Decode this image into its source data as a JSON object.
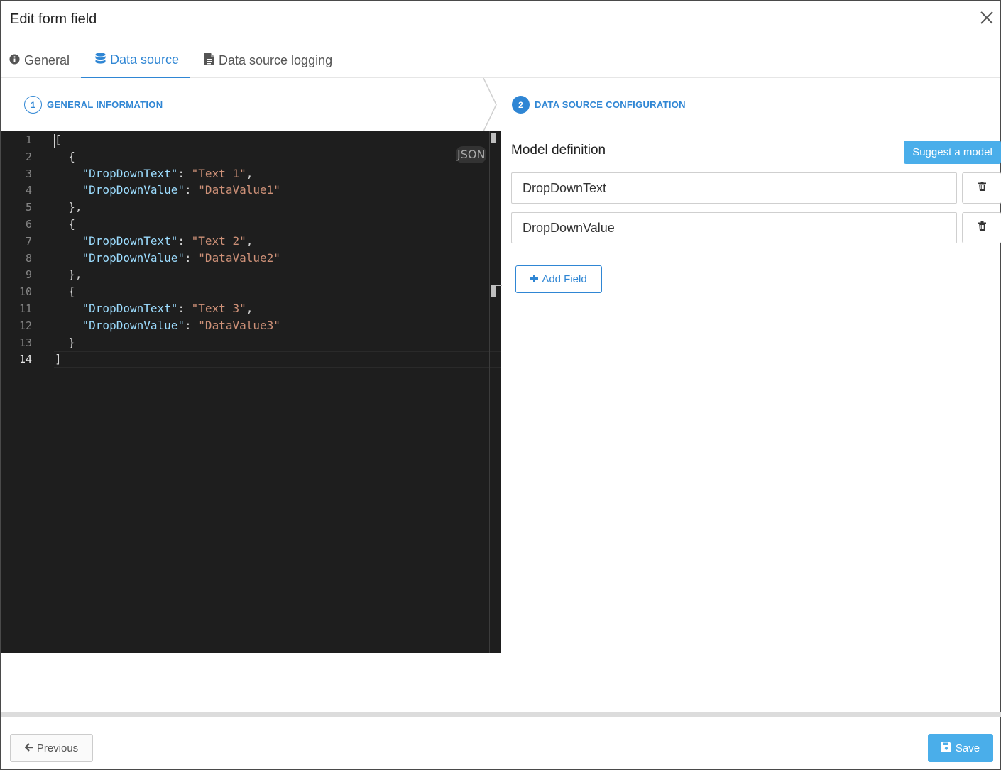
{
  "dialog": {
    "title": "Edit form field",
    "close_icon": "close-icon"
  },
  "tabs": [
    {
      "label": "General",
      "icon": "info-circle-icon",
      "active": false
    },
    {
      "label": "Data source",
      "icon": "database-icon",
      "active": true
    },
    {
      "label": "Data source logging",
      "icon": "file-text-icon",
      "active": false
    }
  ],
  "steps": [
    {
      "number": "1",
      "label": "GENERAL INFORMATION",
      "state": "completed"
    },
    {
      "number": "2",
      "label": "DATA SOURCE CONFIGURATION",
      "state": "current"
    }
  ],
  "editor": {
    "language": "JSON",
    "line_numbers": [
      "1",
      "2",
      "3",
      "4",
      "5",
      "6",
      "7",
      "8",
      "9",
      "10",
      "11",
      "12",
      "13",
      "14"
    ],
    "current_line": "14",
    "lines": [
      [
        {
          "t": "p",
          "v": "["
        }
      ],
      [
        {
          "t": "p",
          "v": "  {"
        }
      ],
      [
        {
          "t": "p",
          "v": "    "
        },
        {
          "t": "k",
          "v": "\"DropDownText\""
        },
        {
          "t": "p",
          "v": ": "
        },
        {
          "t": "s",
          "v": "\"Text 1\""
        },
        {
          "t": "p",
          "v": ","
        }
      ],
      [
        {
          "t": "p",
          "v": "    "
        },
        {
          "t": "k",
          "v": "\"DropDownValue\""
        },
        {
          "t": "p",
          "v": ": "
        },
        {
          "t": "s",
          "v": "\"DataValue1\""
        }
      ],
      [
        {
          "t": "p",
          "v": "  },"
        }
      ],
      [
        {
          "t": "p",
          "v": "  {"
        }
      ],
      [
        {
          "t": "p",
          "v": "    "
        },
        {
          "t": "k",
          "v": "\"DropDownText\""
        },
        {
          "t": "p",
          "v": ": "
        },
        {
          "t": "s",
          "v": "\"Text 2\""
        },
        {
          "t": "p",
          "v": ","
        }
      ],
      [
        {
          "t": "p",
          "v": "    "
        },
        {
          "t": "k",
          "v": "\"DropDownValue\""
        },
        {
          "t": "p",
          "v": ": "
        },
        {
          "t": "s",
          "v": "\"DataValue2\""
        }
      ],
      [
        {
          "t": "p",
          "v": "  },"
        }
      ],
      [
        {
          "t": "p",
          "v": "  {"
        }
      ],
      [
        {
          "t": "p",
          "v": "    "
        },
        {
          "t": "k",
          "v": "\"DropDownText\""
        },
        {
          "t": "p",
          "v": ": "
        },
        {
          "t": "s",
          "v": "\"Text 3\""
        },
        {
          "t": "p",
          "v": ","
        }
      ],
      [
        {
          "t": "p",
          "v": "    "
        },
        {
          "t": "k",
          "v": "\"DropDownValue\""
        },
        {
          "t": "p",
          "v": ": "
        },
        {
          "t": "s",
          "v": "\"DataValue3\""
        }
      ],
      [
        {
          "t": "p",
          "v": "  }"
        }
      ],
      [
        {
          "t": "p",
          "v": "]"
        }
      ]
    ]
  },
  "model": {
    "title": "Model definition",
    "suggest_label": "Suggest a model",
    "fields": [
      {
        "value": "DropDownText",
        "delete_icon": "trash-icon"
      },
      {
        "value": "DropDownValue",
        "delete_icon": "trash-icon"
      }
    ],
    "add_field_label": "Add Field",
    "add_icon": "plus-icon"
  },
  "footer": {
    "previous_label": "Previous",
    "previous_icon": "arrow-left-icon",
    "save_label": "Save",
    "save_icon": "floppy-disk-icon"
  },
  "colors": {
    "accent": "#2f86d4",
    "button_primary": "#4aaeea",
    "editor_bg": "#1e1e1e",
    "json_key": "#9cdcfe",
    "json_string": "#ce9178"
  }
}
